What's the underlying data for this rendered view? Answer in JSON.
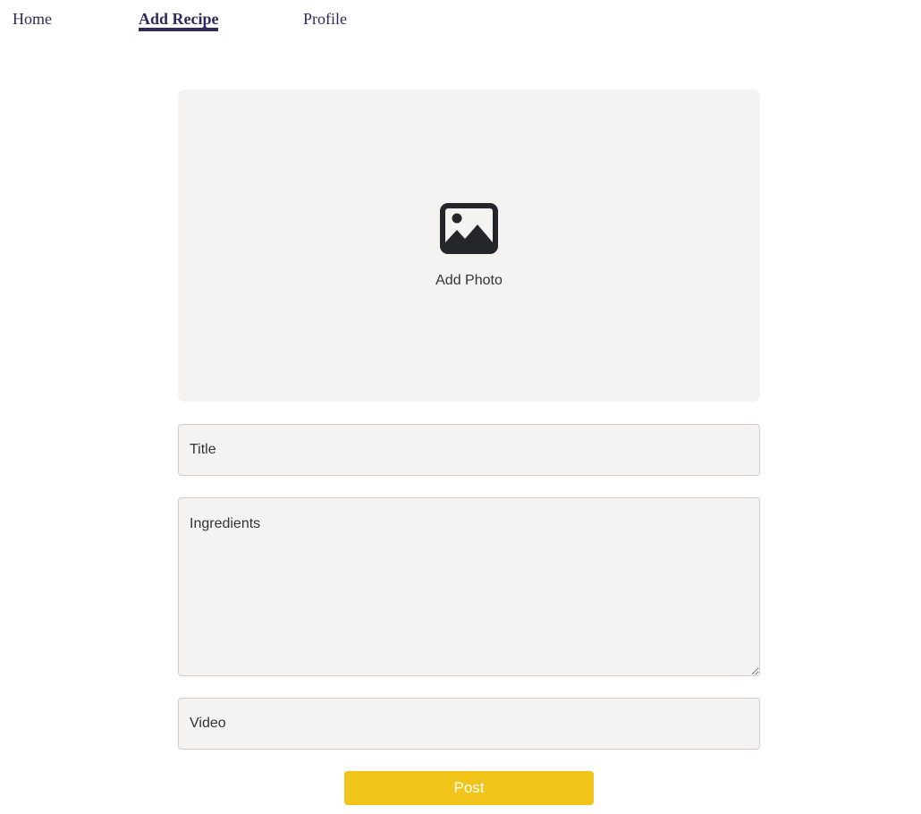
{
  "nav": {
    "home_label": "Home",
    "add_recipe_label": "Add Recipe",
    "profile_label": "Profile"
  },
  "photo": {
    "icon": "image-icon",
    "label": "Add Photo"
  },
  "form": {
    "title_placeholder": "Title",
    "ingredients_placeholder": "Ingredients",
    "video_placeholder": "Video",
    "post_label": "Post"
  },
  "colors": {
    "nav_text": "#2e2a5c",
    "field_background": "#f4f3f2",
    "post_button": "#f0c419"
  }
}
